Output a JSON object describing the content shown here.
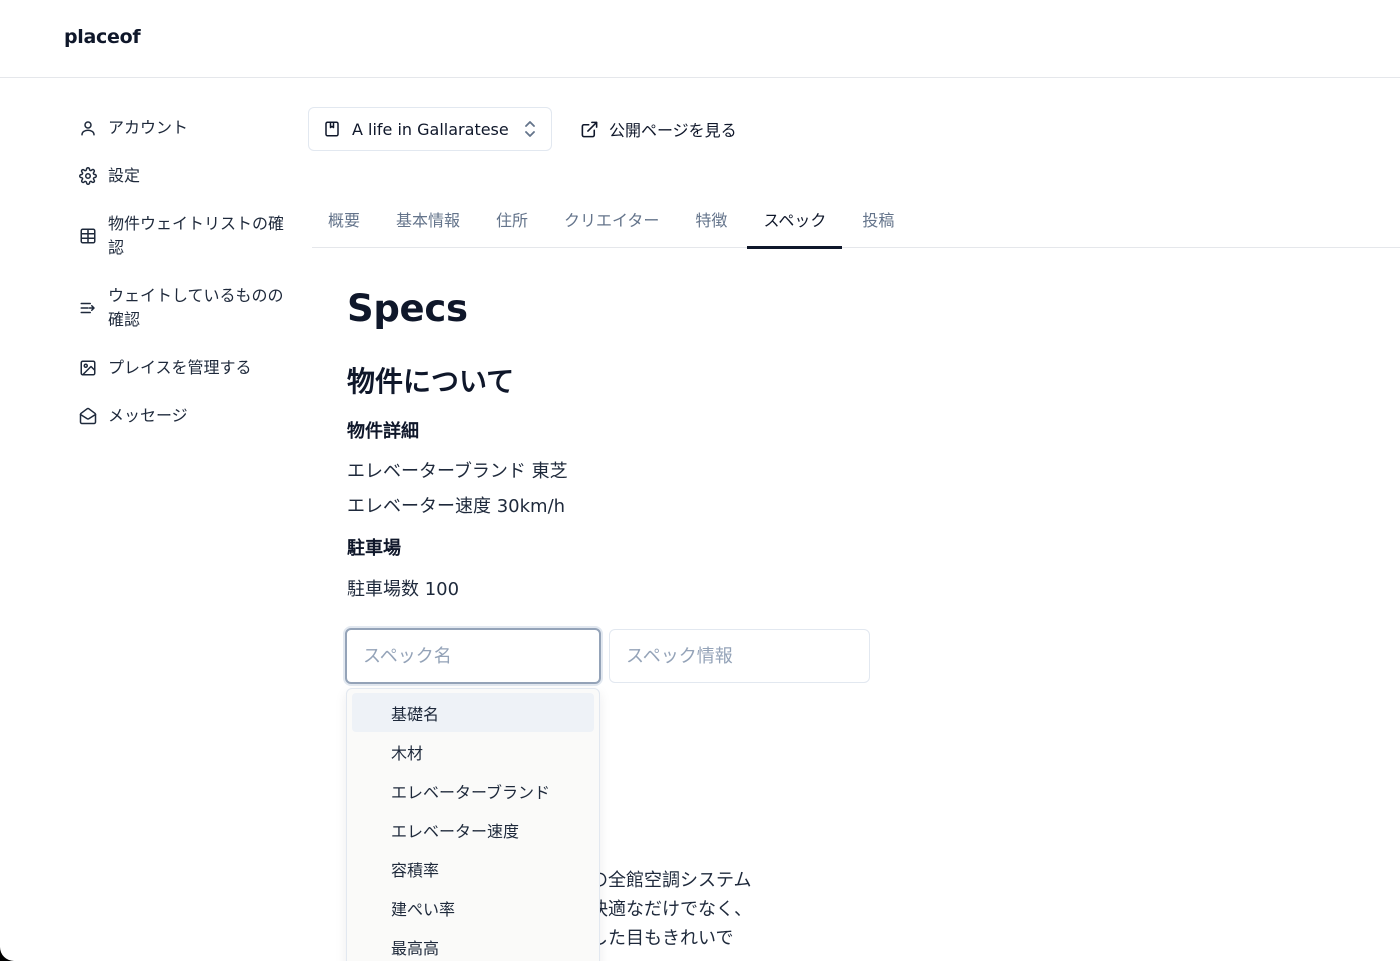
{
  "app": {
    "logo": "placeof"
  },
  "sidebar": {
    "items": [
      {
        "label": "アカウント",
        "icon": "user-icon"
      },
      {
        "label": "設定",
        "icon": "gear-icon"
      },
      {
        "label": "物件ウェイトリストの確認",
        "icon": "table-icon"
      },
      {
        "label": "ウェイトしているものの確認",
        "icon": "list-arrow-icon"
      },
      {
        "label": "プレイスを管理する",
        "icon": "image-icon"
      },
      {
        "label": "メッセージ",
        "icon": "mail-open-icon"
      }
    ]
  },
  "header": {
    "place_switcher": {
      "label": "A life in Gallaratese",
      "icon": "book-icon"
    },
    "public_link": {
      "label": "公開ページを見る",
      "icon": "external-link-icon"
    }
  },
  "tabs": [
    {
      "label": "概要",
      "active": false
    },
    {
      "label": "基本情報",
      "active": false
    },
    {
      "label": "住所",
      "active": false
    },
    {
      "label": "クリエイター",
      "active": false
    },
    {
      "label": "特徴",
      "active": false
    },
    {
      "label": "スペック",
      "active": true
    },
    {
      "label": "投稿",
      "active": false
    }
  ],
  "main": {
    "title": "Specs",
    "section_title": "物件について",
    "groups": [
      {
        "heading": "物件詳細",
        "lines": [
          "エレベーターブランド 東芝",
          "エレベーター速度 30km/h"
        ]
      },
      {
        "heading": "駐車場",
        "lines": [
          "駐車場数 100"
        ]
      }
    ],
    "spec_name_input": {
      "placeholder": "スペック名",
      "value": ""
    },
    "spec_info_input": {
      "placeholder": "スペック情報",
      "value": ""
    },
    "description_lines": [
      "の全館空調システム",
      "快適なだけでなく、",
      "した目もきれいで"
    ]
  },
  "dropdown": {
    "options": [
      "基礎名",
      "木材",
      "エレベーターブランド",
      "エレベーター速度",
      "容積率",
      "建ぺい率",
      "最高高"
    ],
    "highlighted_index": 0
  }
}
